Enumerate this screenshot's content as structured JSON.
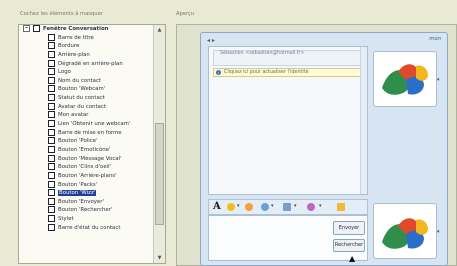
{
  "left_panel": {
    "label": "Cochez les éléments à masquer",
    "items": [
      {
        "label": "Fenêtre Conversation",
        "root": true,
        "expander": "−"
      },
      {
        "label": "Barre de titre"
      },
      {
        "label": "Bordure"
      },
      {
        "label": "Arrière-plan"
      },
      {
        "label": "Dégradé en arrière-plan"
      },
      {
        "label": "Logo"
      },
      {
        "label": "Nom du contact"
      },
      {
        "label": "Bouton 'Webcam'"
      },
      {
        "label": "Statut du contact"
      },
      {
        "label": "Avatar du contact"
      },
      {
        "label": "Mon avatar"
      },
      {
        "label": "Lien 'Obtenir une webcam'"
      },
      {
        "label": "Barre de mise en forme"
      },
      {
        "label": "Bouton 'Police'"
      },
      {
        "label": "Bouton 'Emoticône'"
      },
      {
        "label": "Bouton 'Message Vocal'"
      },
      {
        "label": "Bouton 'Clins d'oeil'"
      },
      {
        "label": "Bouton 'Arrière-plans'"
      },
      {
        "label": "Bouton 'Packs'"
      },
      {
        "label": "Bouton 'Wizz'",
        "selected": true
      },
      {
        "label": "Bouton 'Envoyer'"
      },
      {
        "label": "Bouton 'Rechercher'"
      },
      {
        "label": "Stylet"
      },
      {
        "label": "Barre d'état du contact"
      }
    ],
    "scroll": {
      "up": "▲",
      "down": "▼"
    }
  },
  "right_panel": {
    "label": "Aperçu"
  },
  "chat": {
    "logo": "msn",
    "window_controls": "◂ ▸",
    "header_text": "Sébastien <sebastien@hotmail.fr>",
    "info_text": "Cliquez ici pour actualiser l'identité",
    "info_icon": "i",
    "toolbar": {
      "font_label": "A",
      "dropdown": "▾"
    },
    "send_label": "Envoyer",
    "search_label": "Rechercher",
    "cursor": "▲",
    "avatar_dropdown": "▾"
  },
  "colors": {
    "selection": "#243f9b",
    "window_bg": "#d7e4f1"
  }
}
